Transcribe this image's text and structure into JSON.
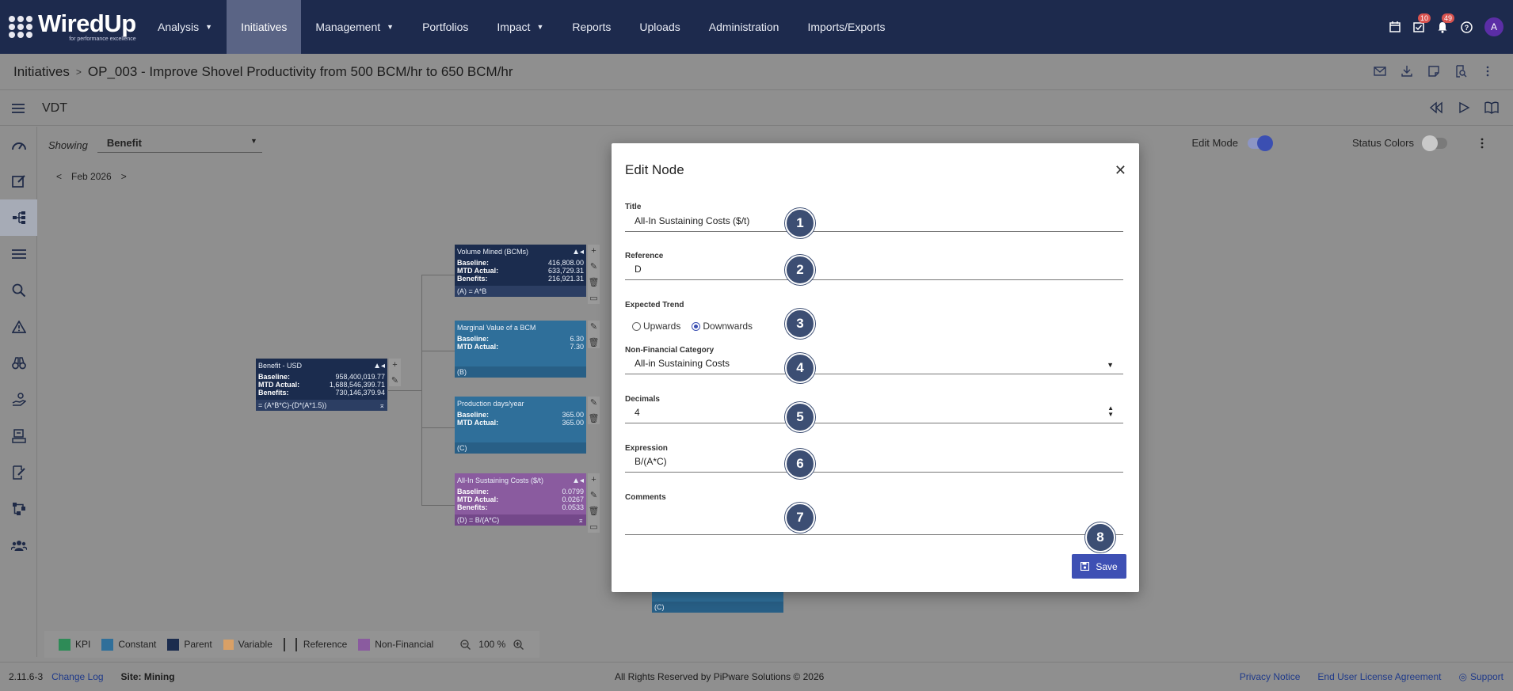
{
  "nav": {
    "logo_name": "WiredUp",
    "logo_tagline": "for performance excellence",
    "items": [
      {
        "label": "Analysis",
        "caret": true
      },
      {
        "label": "Initiatives",
        "active": true
      },
      {
        "label": "Management",
        "caret": true
      },
      {
        "label": "Portfolios"
      },
      {
        "label": "Impact",
        "caret": true
      },
      {
        "label": "Reports"
      },
      {
        "label": "Uploads"
      },
      {
        "label": "Administration"
      },
      {
        "label": "Imports/Exports"
      }
    ],
    "tasks_badge": "10",
    "notifications_badge": "49",
    "avatar_initial": "A"
  },
  "breadcrumb": {
    "root": "Initiatives",
    "current": "OP_003 - Improve Shovel Productivity from 500 BCM/hr to 650 BCM/hr"
  },
  "vdt": {
    "title": "VDT"
  },
  "showing": {
    "label": "Showing",
    "value": "Benefit"
  },
  "period": {
    "label": "Feb 2026"
  },
  "toggles": {
    "edit_mode": "Edit Mode",
    "status_colors": "Status Colors"
  },
  "nodes": {
    "benefit": {
      "title": "Benefit - USD",
      "baseline_label": "Baseline:",
      "baseline": "958,400,019.77",
      "mtd_label": "MTD Actual:",
      "mtd": "1,688,546,399.71",
      "benefits_label": "Benefits:",
      "benefits": "730,146,379.94",
      "formula": "= (A*B*C)-(D*(A*1.5))"
    },
    "volume": {
      "title": "Volume Mined (BCMs)",
      "baseline_label": "Baseline:",
      "baseline": "416,808.00",
      "mtd_label": "MTD Actual:",
      "mtd": "633,729.31",
      "benefits_label": "Benefits:",
      "benefits": "216,921.31",
      "formula": "(A) = A*B"
    },
    "marginal": {
      "title": "Marginal Value of a BCM",
      "baseline_label": "Baseline:",
      "baseline": "6.30",
      "mtd_label": "MTD Actual:",
      "mtd": "7.30",
      "formula": "(B)"
    },
    "production": {
      "title": "Production days/year",
      "baseline_label": "Baseline:",
      "baseline": "365.00",
      "mtd_label": "MTD Actual:",
      "mtd": "365.00",
      "formula": "(C)"
    },
    "aisc": {
      "title": "All-In Sustaining Costs ($/t)",
      "baseline_label": "Baseline:",
      "baseline": "0.0799",
      "mtd_label": "MTD Actual:",
      "mtd": "0.0267",
      "benefits_label": "Benefits:",
      "benefits": "0.0533",
      "formula": "(D) = B/(A*C)"
    },
    "hidden_c": {
      "formula": "(C)"
    }
  },
  "legend": {
    "items": [
      {
        "label": "KPI",
        "color": "#2e8b57"
      },
      {
        "label": "Constant",
        "color": "#2f6f9a"
      },
      {
        "label": "Parent",
        "color": "#1b2c4e"
      },
      {
        "label": "Variable",
        "color": "#d9a066"
      },
      {
        "label": "Reference",
        "color": "bracket"
      },
      {
        "label": "Non-Financial",
        "color": "#8a5b9f"
      }
    ],
    "zoom": "100 %"
  },
  "footer": {
    "version": "2.11.6-3",
    "change_log": "Change Log",
    "site": "Site: Mining",
    "copyright": "All Rights Reserved by PiPware Solutions © 2026",
    "privacy": "Privacy Notice",
    "eula": "End User License Agreement",
    "support": "Support"
  },
  "modal": {
    "title": "Edit Node",
    "fields": {
      "title_label": "Title",
      "title_value": "All-In Sustaining Costs ($/t)",
      "reference_label": "Reference",
      "reference_value": "D",
      "trend_label": "Expected Trend",
      "trend_up": "Upwards",
      "trend_down": "Downwards",
      "trend_selected": "Downwards",
      "category_label": "Non-Financial Category",
      "category_value": "All-in Sustaining Costs",
      "decimals_label": "Decimals",
      "decimals_value": "4",
      "expression_label": "Expression",
      "expression_value": "B/(A*C)",
      "comments_label": "Comments",
      "comments_value": ""
    },
    "save_label": "Save"
  },
  "markers": [
    "1",
    "2",
    "3",
    "4",
    "5",
    "6",
    "7",
    "8"
  ]
}
